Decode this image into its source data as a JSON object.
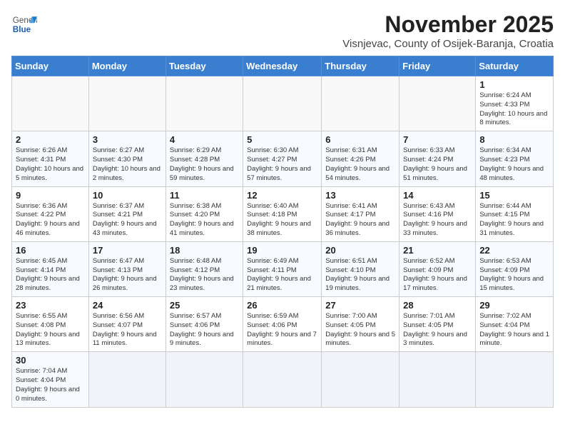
{
  "header": {
    "logo_general": "General",
    "logo_blue": "Blue",
    "month_year": "November 2025",
    "location": "Visnjevac, County of Osijek-Baranja, Croatia"
  },
  "weekdays": [
    "Sunday",
    "Monday",
    "Tuesday",
    "Wednesday",
    "Thursday",
    "Friday",
    "Saturday"
  ],
  "weeks": [
    [
      {
        "day": "",
        "info": ""
      },
      {
        "day": "",
        "info": ""
      },
      {
        "day": "",
        "info": ""
      },
      {
        "day": "",
        "info": ""
      },
      {
        "day": "",
        "info": ""
      },
      {
        "day": "",
        "info": ""
      },
      {
        "day": "1",
        "info": "Sunrise: 6:24 AM\nSunset: 4:33 PM\nDaylight: 10 hours and 8 minutes."
      }
    ],
    [
      {
        "day": "2",
        "info": "Sunrise: 6:26 AM\nSunset: 4:31 PM\nDaylight: 10 hours and 5 minutes."
      },
      {
        "day": "3",
        "info": "Sunrise: 6:27 AM\nSunset: 4:30 PM\nDaylight: 10 hours and 2 minutes."
      },
      {
        "day": "4",
        "info": "Sunrise: 6:29 AM\nSunset: 4:28 PM\nDaylight: 9 hours and 59 minutes."
      },
      {
        "day": "5",
        "info": "Sunrise: 6:30 AM\nSunset: 4:27 PM\nDaylight: 9 hours and 57 minutes."
      },
      {
        "day": "6",
        "info": "Sunrise: 6:31 AM\nSunset: 4:26 PM\nDaylight: 9 hours and 54 minutes."
      },
      {
        "day": "7",
        "info": "Sunrise: 6:33 AM\nSunset: 4:24 PM\nDaylight: 9 hours and 51 minutes."
      },
      {
        "day": "8",
        "info": "Sunrise: 6:34 AM\nSunset: 4:23 PM\nDaylight: 9 hours and 48 minutes."
      }
    ],
    [
      {
        "day": "9",
        "info": "Sunrise: 6:36 AM\nSunset: 4:22 PM\nDaylight: 9 hours and 46 minutes."
      },
      {
        "day": "10",
        "info": "Sunrise: 6:37 AM\nSunset: 4:21 PM\nDaylight: 9 hours and 43 minutes."
      },
      {
        "day": "11",
        "info": "Sunrise: 6:38 AM\nSunset: 4:20 PM\nDaylight: 9 hours and 41 minutes."
      },
      {
        "day": "12",
        "info": "Sunrise: 6:40 AM\nSunset: 4:18 PM\nDaylight: 9 hours and 38 minutes."
      },
      {
        "day": "13",
        "info": "Sunrise: 6:41 AM\nSunset: 4:17 PM\nDaylight: 9 hours and 36 minutes."
      },
      {
        "day": "14",
        "info": "Sunrise: 6:43 AM\nSunset: 4:16 PM\nDaylight: 9 hours and 33 minutes."
      },
      {
        "day": "15",
        "info": "Sunrise: 6:44 AM\nSunset: 4:15 PM\nDaylight: 9 hours and 31 minutes."
      }
    ],
    [
      {
        "day": "16",
        "info": "Sunrise: 6:45 AM\nSunset: 4:14 PM\nDaylight: 9 hours and 28 minutes."
      },
      {
        "day": "17",
        "info": "Sunrise: 6:47 AM\nSunset: 4:13 PM\nDaylight: 9 hours and 26 minutes."
      },
      {
        "day": "18",
        "info": "Sunrise: 6:48 AM\nSunset: 4:12 PM\nDaylight: 9 hours and 23 minutes."
      },
      {
        "day": "19",
        "info": "Sunrise: 6:49 AM\nSunset: 4:11 PM\nDaylight: 9 hours and 21 minutes."
      },
      {
        "day": "20",
        "info": "Sunrise: 6:51 AM\nSunset: 4:10 PM\nDaylight: 9 hours and 19 minutes."
      },
      {
        "day": "21",
        "info": "Sunrise: 6:52 AM\nSunset: 4:09 PM\nDaylight: 9 hours and 17 minutes."
      },
      {
        "day": "22",
        "info": "Sunrise: 6:53 AM\nSunset: 4:09 PM\nDaylight: 9 hours and 15 minutes."
      }
    ],
    [
      {
        "day": "23",
        "info": "Sunrise: 6:55 AM\nSunset: 4:08 PM\nDaylight: 9 hours and 13 minutes."
      },
      {
        "day": "24",
        "info": "Sunrise: 6:56 AM\nSunset: 4:07 PM\nDaylight: 9 hours and 11 minutes."
      },
      {
        "day": "25",
        "info": "Sunrise: 6:57 AM\nSunset: 4:06 PM\nDaylight: 9 hours and 9 minutes."
      },
      {
        "day": "26",
        "info": "Sunrise: 6:59 AM\nSunset: 4:06 PM\nDaylight: 9 hours and 7 minutes."
      },
      {
        "day": "27",
        "info": "Sunrise: 7:00 AM\nSunset: 4:05 PM\nDaylight: 9 hours and 5 minutes."
      },
      {
        "day": "28",
        "info": "Sunrise: 7:01 AM\nSunset: 4:05 PM\nDaylight: 9 hours and 3 minutes."
      },
      {
        "day": "29",
        "info": "Sunrise: 7:02 AM\nSunset: 4:04 PM\nDaylight: 9 hours and 1 minute."
      }
    ],
    [
      {
        "day": "30",
        "info": "Sunrise: 7:04 AM\nSunset: 4:04 PM\nDaylight: 9 hours and 0 minutes."
      },
      {
        "day": "",
        "info": ""
      },
      {
        "day": "",
        "info": ""
      },
      {
        "day": "",
        "info": ""
      },
      {
        "day": "",
        "info": ""
      },
      {
        "day": "",
        "info": ""
      },
      {
        "day": "",
        "info": ""
      }
    ]
  ]
}
